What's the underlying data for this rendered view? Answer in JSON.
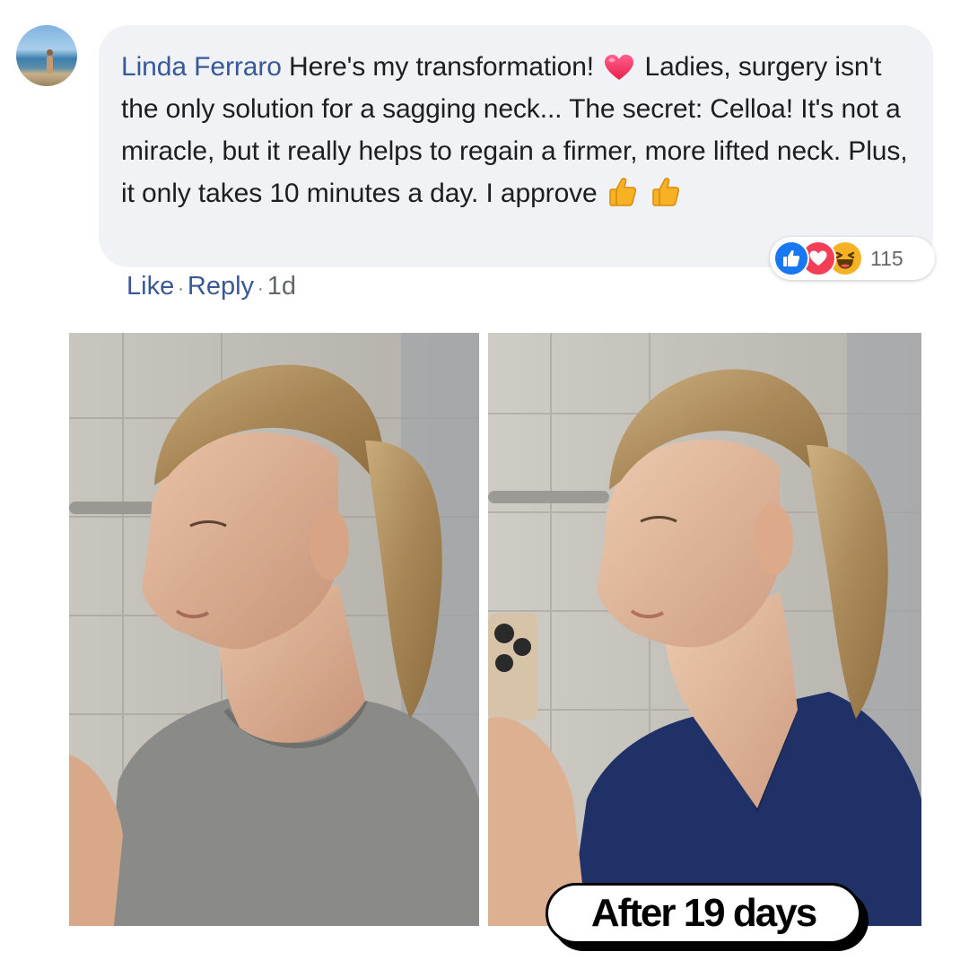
{
  "comment": {
    "author": "Linda Ferraro",
    "text_part1": "Here's my transformation!",
    "text_part2": "Ladies, surgery isn't the only solution for a sagging neck... The secret: Celloa! It's not a miracle, but it really helps to regain a firmer, more lifted neck. Plus, it only takes 10 minutes a day. I approve",
    "emojis": [
      "heart-emoji",
      "thumbs-up-emoji",
      "thumbs-up-emoji"
    ],
    "author_color": "#385898",
    "bubble_color": "#f0f2f5"
  },
  "reactions": {
    "icons": [
      "like-reaction-icon",
      "love-reaction-icon",
      "haha-reaction-icon"
    ],
    "count": "115"
  },
  "actions": {
    "like_label": "Like",
    "reply_label": "Reply",
    "separator": "·",
    "time": "1d"
  },
  "photos": {
    "before": "before-photo",
    "after": "after-photo"
  },
  "caption": "After 19 days"
}
